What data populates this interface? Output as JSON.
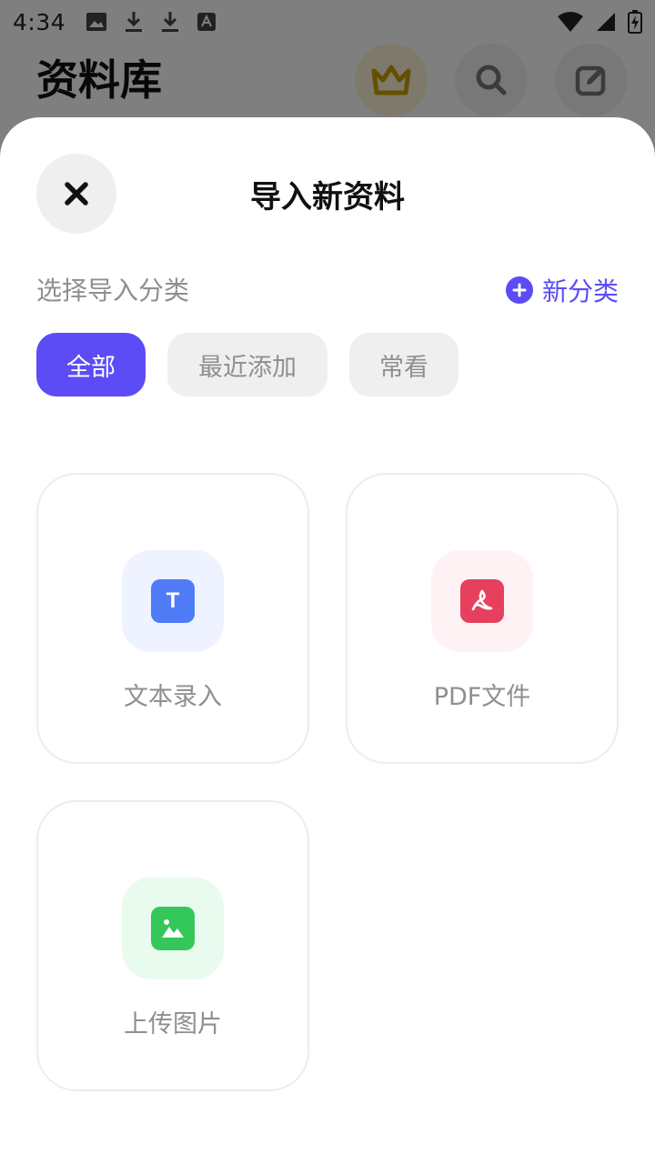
{
  "status_bar": {
    "time": "4:34",
    "left_icons": [
      "image-icon",
      "download-icon",
      "download-icon",
      "font-icon"
    ],
    "right_icons": [
      "wifi-icon",
      "signal-icon",
      "battery-charging-icon"
    ]
  },
  "background_app": {
    "title": "资料库",
    "buttons": [
      "crown-icon",
      "search-icon",
      "edit-icon"
    ],
    "crown_color": "#c9a000"
  },
  "sheet": {
    "title": "导入新资料",
    "close_icon": "close-icon",
    "section_label": "选择导入分类",
    "new_category_label": "新分类",
    "accent_color": "#5b4cf5",
    "categories": [
      {
        "label": "全部",
        "active": true
      },
      {
        "label": "最近添加",
        "active": false
      },
      {
        "label": "常看",
        "active": false
      }
    ],
    "import_options": [
      {
        "label": "文本录入",
        "icon": "text-icon",
        "icon_glyph": "T",
        "icon_color": "#4f7cf6",
        "icon_bg": "#eef3ff"
      },
      {
        "label": "PDF文件",
        "icon": "pdf-icon",
        "icon_color": "#e5415f",
        "icon_bg": "#fff2f4"
      },
      {
        "label": "上传图片",
        "icon": "picture-icon",
        "icon_color": "#34c759",
        "icon_bg": "#e9fbee"
      }
    ]
  }
}
